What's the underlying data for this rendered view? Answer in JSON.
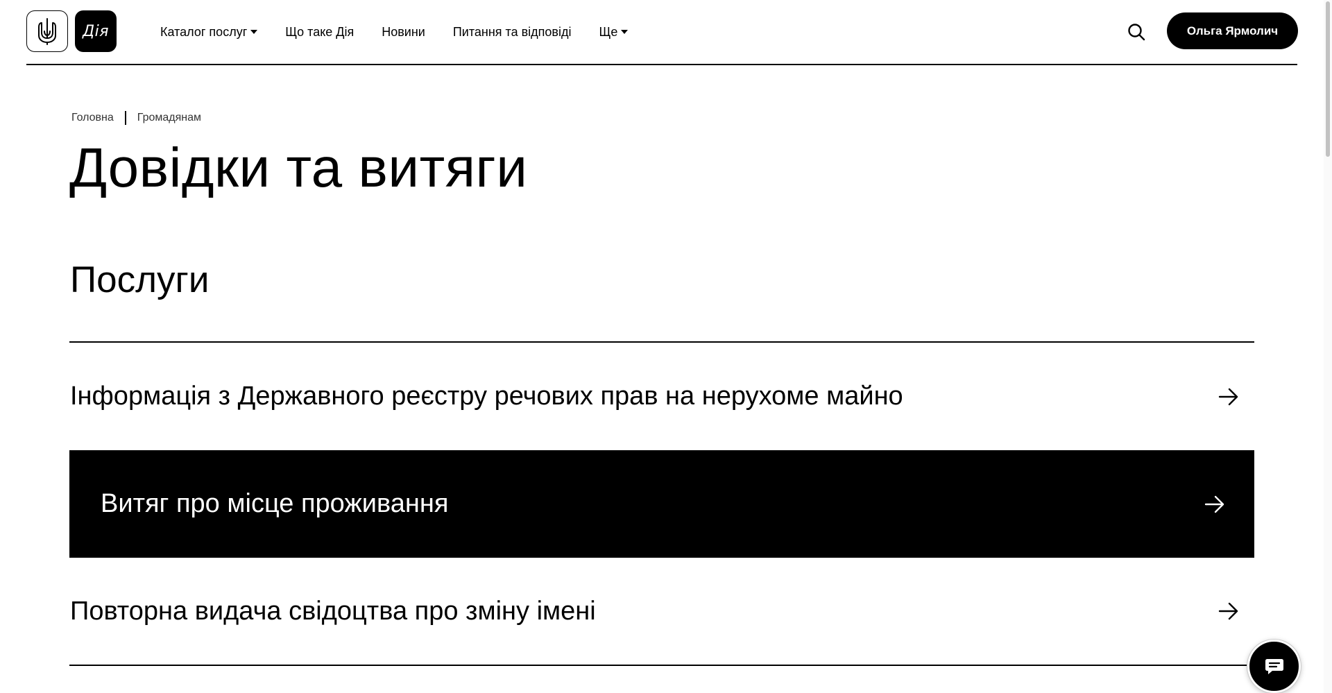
{
  "header": {
    "logo_trident_icon": "trident-icon",
    "logo_text": "Дія",
    "nav": [
      {
        "label": "Каталог послуг",
        "has_dropdown": true
      },
      {
        "label": "Що таке Дія",
        "has_dropdown": false
      },
      {
        "label": "Новини",
        "has_dropdown": false
      },
      {
        "label": "Питання та відповіді",
        "has_dropdown": false
      },
      {
        "label": "Ще",
        "has_dropdown": true
      }
    ],
    "search_icon": "search-icon",
    "user_name": "Ольга Ярмолич"
  },
  "breadcrumb": [
    "Головна",
    "Громадянам"
  ],
  "page_title": "Довідки та витяги",
  "section_title": "Послуги",
  "services": [
    {
      "label": "Інформація з Державного реєстру речових прав на нерухоме майно",
      "highlighted": false
    },
    {
      "label": "Витяг про місце проживання",
      "highlighted": true
    },
    {
      "label": "Повторна видача свідоцтва про зміну імені",
      "highlighted": false
    }
  ],
  "chat_icon": "chat-icon",
  "colors": {
    "primary": "#000000",
    "background": "#ffffff"
  }
}
